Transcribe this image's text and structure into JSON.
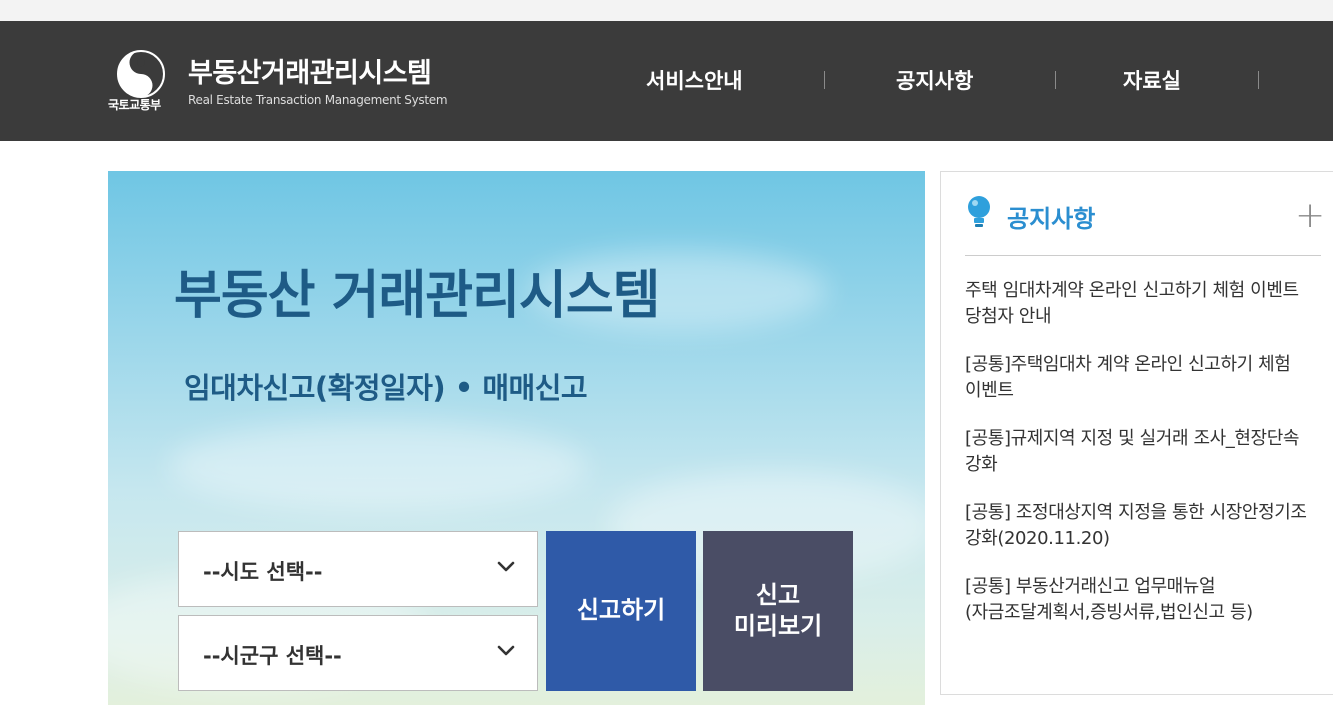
{
  "header": {
    "ministry": "국토교통부",
    "title": "부동산거래관리시스템",
    "subtitle": "Real Estate Transaction Management System",
    "nav": [
      "서비스안내",
      "공지사항",
      "자료실"
    ]
  },
  "hero": {
    "title": "부동산 거래관리시스템",
    "subtitle": "임대차신고(확정일자) • 매매신고",
    "sido_select": "--시도 선택--",
    "sigungu_select": "--시군구 선택--",
    "report_button": "신고하기",
    "preview_button_line1": "신고",
    "preview_button_line2": "미리보기"
  },
  "notice": {
    "title": "공지사항",
    "more": "+",
    "items": [
      "주택 임대차계약 온라인 신고하기 체험 이벤트 당첨자 안내",
      "[공통]주택임대차 계약 온라인 신고하기 체험 이벤트",
      "[공통]규제지역 지정 및 실거래 조사_현장단속 강화",
      "[공통] 조정대상지역 지정을 통한 시장안정기조 강화(2020.11.20)",
      "[공통] 부동산거래신고 업무매뉴얼(자금조달계획서,증빙서류,법인신고 등)"
    ]
  },
  "colors": {
    "header_bg": "#3b3b3b",
    "report_button": "#2f5aa8",
    "preview_button": "#4a4d65",
    "notice_title": "#2b8ed0",
    "hero_text": "#1e5b86"
  },
  "icons": [
    "government-emblem-icon",
    "chevron-down-icon",
    "lightbulb-icon",
    "plus-icon"
  ]
}
